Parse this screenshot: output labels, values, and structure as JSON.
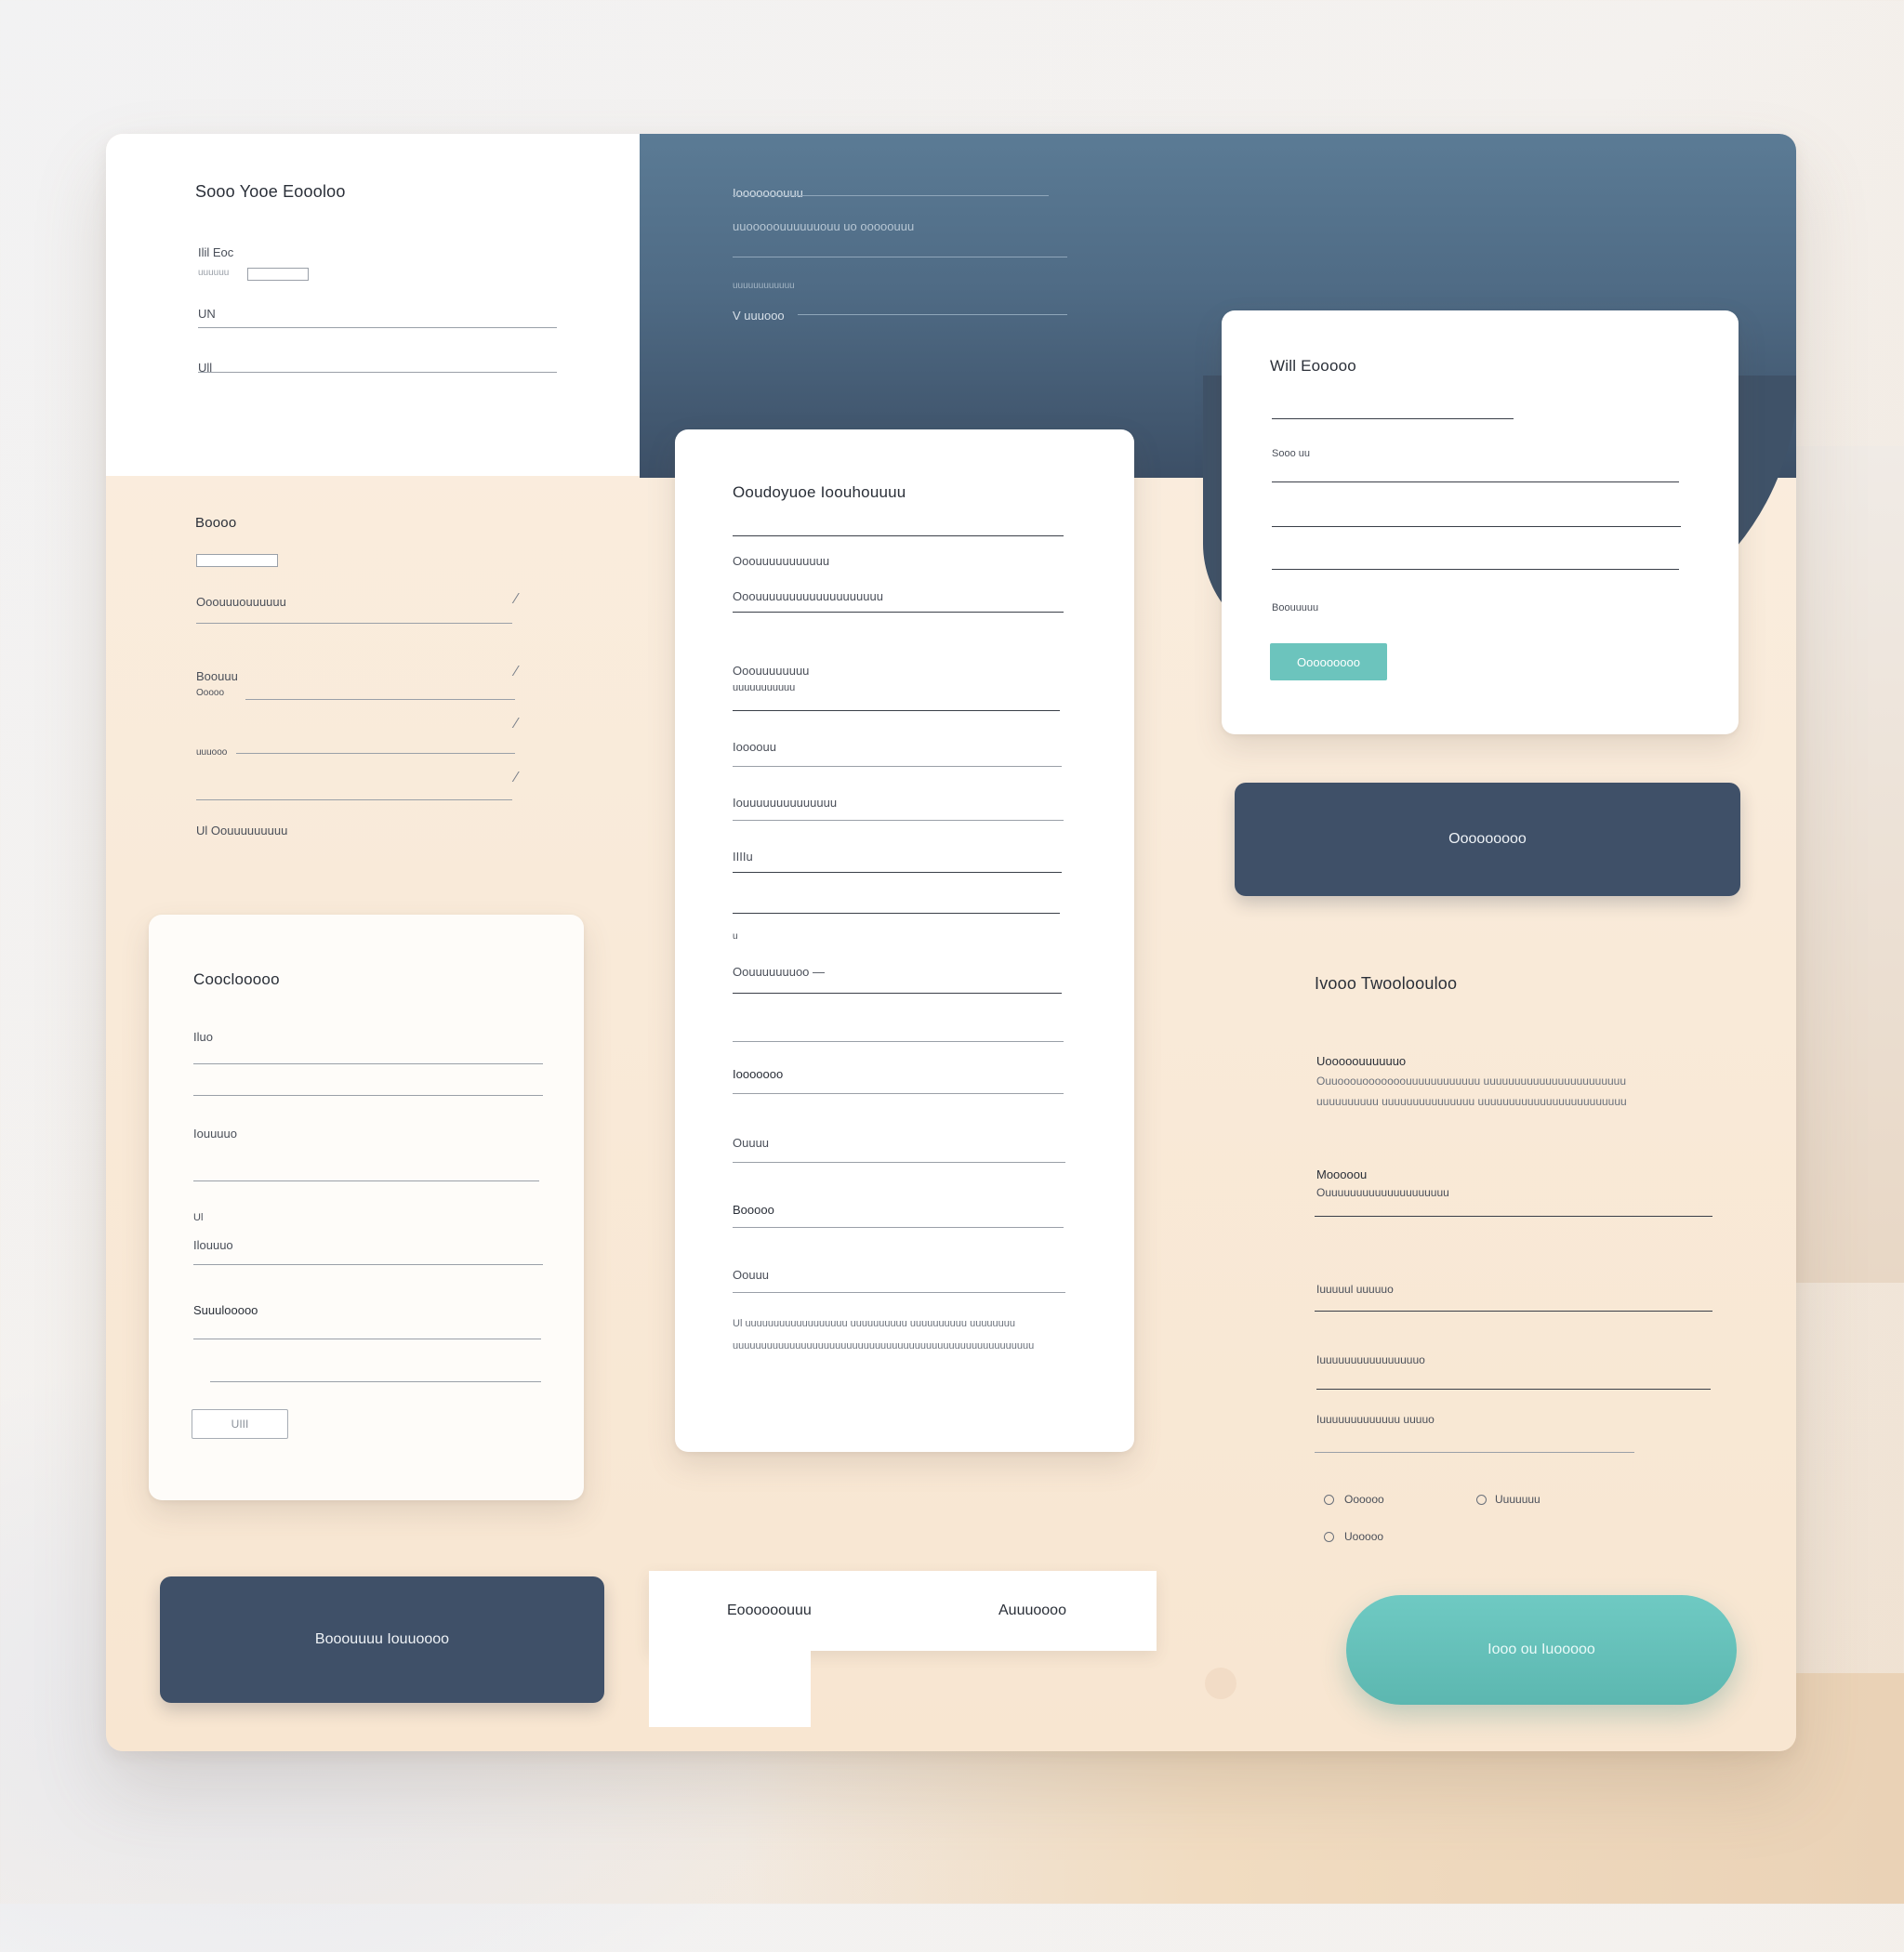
{
  "top_left_panel": {
    "title": "Sooo Yooe Eoooloo",
    "label_1": "Ilil Eoc",
    "label_2": "uuuuuu",
    "label_3": "UN",
    "label_4": "Ull"
  },
  "blue_panel": {
    "label_1": "Iooooooouuu",
    "label_2": "uuooooouuuuuuouu uo ooooouuu",
    "label_3": "uuuuuuuuuuuu",
    "label_4": "V uuuooo"
  },
  "left_section": {
    "title": "Boooo",
    "field_1": "Ooouuuouuuuuu",
    "field_2_a": "Boouuu",
    "field_2_b": "Ooooo",
    "field_3": "uuuooo",
    "footer": "Ul Oouuuuuuuuu"
  },
  "bottom_left_card": {
    "title": "Cooclooooo",
    "field_1": "Iluo",
    "field_2": "Iouuuuo",
    "field_3_a": "Ul",
    "field_3_b": "Ilouuuo",
    "field_4": "Suuulooooo",
    "button": "UIII"
  },
  "center_card": {
    "title": "Ooudoyuoe Ioouhouuuu",
    "label_1": "Ooouuuuuuuuuuu",
    "label_2": "Ooouuuuuuuuuuuuuuuuuuu",
    "label_3_a": "Ooouuuuuuuu",
    "label_3_b": "uuuuuuuuuuu",
    "label_4": "Ioooouu",
    "label_5": "Iouuuuuuuuuuuuuu",
    "label_6": "IIIIu",
    "label_7": "u",
    "label_8": "Oouuuuuuuoo —",
    "label_9": "Iooooooo",
    "label_10": "Ouuuu",
    "label_11": "Booooo",
    "label_12": "Oouuu",
    "text_1": "Ul uuuuuuuuuuuuuuuuuu uuuuuuuuuu uuuuuuuuuu uuuuuuuu",
    "text_2": "uuuuuuuuuuuuuuuuuuuuuuuuuuuuuuuuuuuuuuuuuuuuuuuuuuuuu"
  },
  "right_card": {
    "title": "Will Eooooo",
    "label_1": "Sooo uu",
    "label_2": "Boouuuuu",
    "button": "Ooooooooo"
  },
  "right_navy_button": {
    "label": "Ooooooooo"
  },
  "right_section": {
    "title": "Ivooo Twooloouloo",
    "label_1": "Uooooouuuuuuo",
    "text_1": "Ouuooouooooooouuuuuuuuuuuu uuuuuuuuuuuuuuuuuuuuuuu",
    "text_2": "uuuuuuuuuu uuuuuuuuuuuuuuu uuuuuuuuuuuuuuuuuuuuuuuu",
    "label_2": "Mooooou",
    "label_3": "Ouuuuuuuuuuuuuuuuuuuu",
    "label_4": "Iuuuuul uuuuuo",
    "label_5": "Iuuuuuuuuuuuuuuuuo",
    "label_6": "Iuuuuuuuuuuuuu uuuuo",
    "radio_1": "Oooooo",
    "radio_2": "Uuuuuuu",
    "radio_3": "Uooooo"
  },
  "bottom_navy_button": {
    "label": "Booouuuu Iouuoooo"
  },
  "tabs": {
    "tab_1": "Eoooooouuu",
    "tab_2": "Auuuoooo"
  },
  "teal_pill_button": {
    "label": "Iooo ou Iuooooo"
  },
  "colors": {
    "navy": "#3f5068",
    "slate_blue": "#5b7b95",
    "teal": "#6cc4bd",
    "cream": "#faeee0",
    "white": "#ffffff"
  }
}
